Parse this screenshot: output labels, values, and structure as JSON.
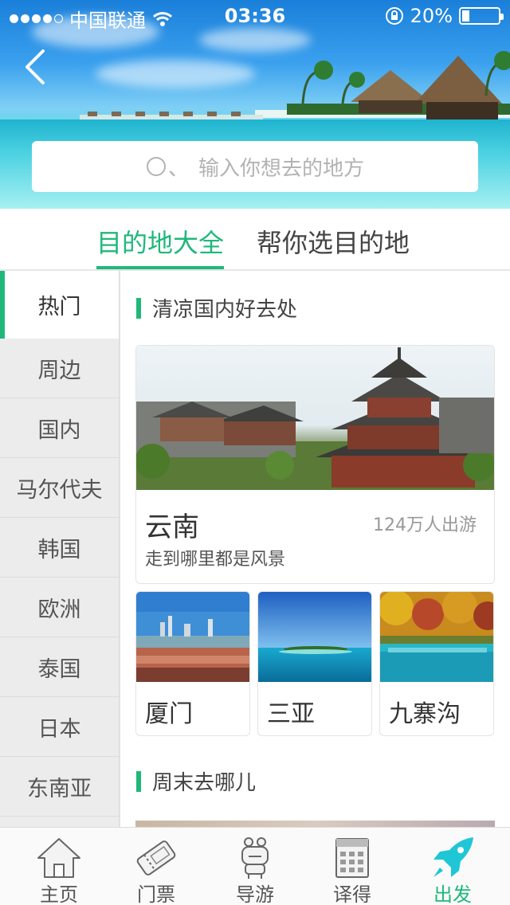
{
  "status_bar": {
    "carrier": "中国联通",
    "time": "03:36",
    "battery": "20%",
    "battery_level": 0.2
  },
  "search": {
    "placeholder": "输入你想去的地方",
    "prefix_glyph": "、"
  },
  "tabs": [
    {
      "label": "目的地大全",
      "active": true
    },
    {
      "label": "帮你选目的地",
      "active": false
    }
  ],
  "sidebar": {
    "items": [
      {
        "label": "热门",
        "active": true
      },
      {
        "label": "周边"
      },
      {
        "label": "国内"
      },
      {
        "label": "马尔代夫"
      },
      {
        "label": "韩国"
      },
      {
        "label": "欧洲"
      },
      {
        "label": "泰国"
      },
      {
        "label": "日本"
      },
      {
        "label": "东南亚"
      }
    ]
  },
  "sections": [
    {
      "title": "清凉国内好去处",
      "featured": {
        "name": "云南",
        "count": "124万人出游",
        "desc": "走到哪里都是风景"
      },
      "cards": [
        {
          "name": "厦门"
        },
        {
          "name": "三亚"
        },
        {
          "name": "九寨沟"
        }
      ]
    },
    {
      "title": "周末去哪儿"
    }
  ],
  "bottom_nav": [
    {
      "label": "主页",
      "icon": "house-icon"
    },
    {
      "label": "门票",
      "icon": "ticket-icon"
    },
    {
      "label": "导游",
      "icon": "robot-guide-icon"
    },
    {
      "label": "译得",
      "icon": "calendar-icon"
    },
    {
      "label": "出发",
      "icon": "rocket-icon",
      "active": true
    }
  ],
  "colors": {
    "accent": "#1fb87a",
    "sidebar_bg": "#ececec"
  }
}
